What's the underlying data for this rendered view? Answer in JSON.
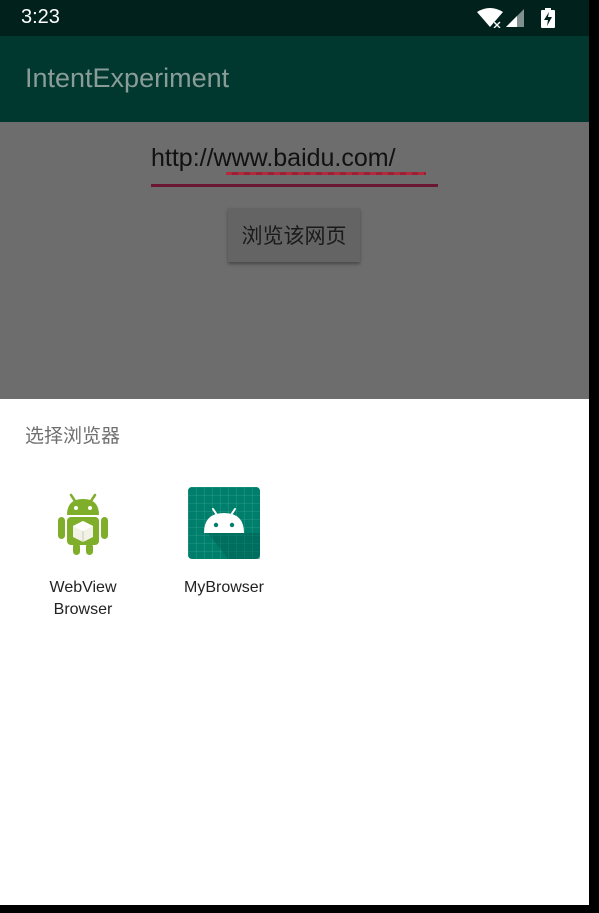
{
  "status_bar": {
    "time": "3:23",
    "icons": [
      "wifi-icon",
      "signal-icon",
      "battery-charging-icon"
    ]
  },
  "app_bar": {
    "title": "IntentExperiment"
  },
  "main": {
    "url_input": {
      "value": "http://www.baidu.com/"
    },
    "browse_button_label": "浏览该网页"
  },
  "chooser": {
    "title": "选择浏览器",
    "apps": [
      {
        "label_lines": [
          "WebView",
          "Browser"
        ],
        "icon": "android-robot-icon"
      },
      {
        "label_lines": [
          "MyBrowser"
        ],
        "icon": "android-app-icon"
      }
    ]
  },
  "colors": {
    "status_bar": "#00211c",
    "app_bar": "#00382f",
    "title_text": "#8a9c98",
    "dimmed_content": "#6d6d6d",
    "underline": "#6b1734",
    "sheet_background": "#ffffff",
    "mybrowser_icon": "#007e6c",
    "android_green": "#7fae2b"
  }
}
